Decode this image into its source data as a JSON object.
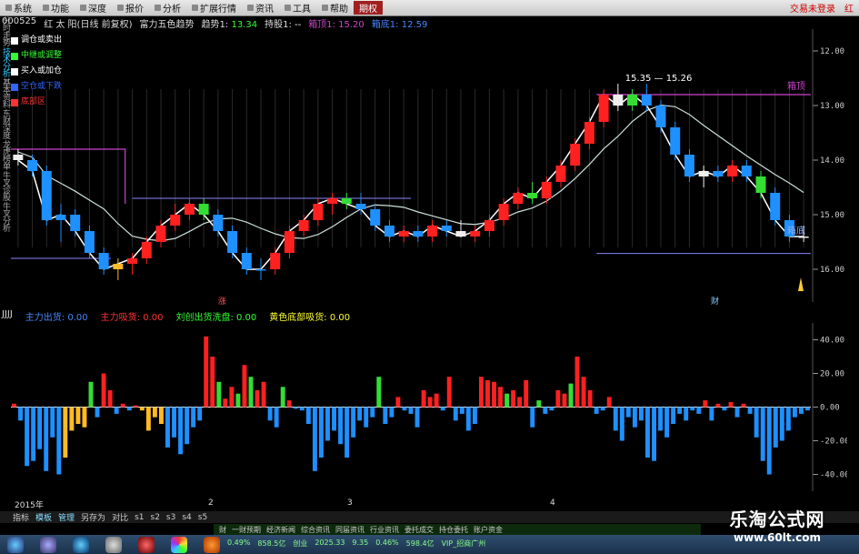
{
  "menu": {
    "items": [
      "系统",
      "功能",
      "深度",
      "报价",
      "分析",
      "扩展行情",
      "资讯",
      "工具",
      "帮助",
      "期权"
    ],
    "right": [
      "交易未登录",
      "红"
    ]
  },
  "left_tabs": [
    "分时走势",
    "技术分析",
    "基本资料",
    "东财深度",
    "龙虎榜单",
    "牛叉诊股",
    "牛叉分析"
  ],
  "info": {
    "code": "000525",
    "name": "红 太 阳(日线 前复权)",
    "indicator": "富力五色趋势",
    "trend_label": "趋势1:",
    "trend_value": "13.34",
    "hold_label": "持股1:",
    "hold_value": "--",
    "top_label": "箱顶1:",
    "top_value": "15.20",
    "bottom_label": "箱底1:",
    "bottom_value": "12.59"
  },
  "legend": [
    {
      "label": "调仓或卖出",
      "color": "#ffffff"
    },
    {
      "label": "中继或调整",
      "color": "#33ff33"
    },
    {
      "label": "买入或加仓",
      "color": "#ffffff"
    },
    {
      "label": "空仓或下跌",
      "color": "#3366ff"
    },
    {
      "label": "底部区",
      "color": "#ff3333"
    }
  ],
  "price_chart": {
    "range_text": "15.35 — 15.26",
    "box_top_label": "箱顶",
    "box_bottom_label": "箱底",
    "marker_zhang": "涨",
    "marker_cai": "财",
    "y_ticks": [
      "16.00",
      "15.00",
      "14.00",
      "13.00",
      "12.00"
    ]
  },
  "osc": {
    "name": "JJJJ",
    "f1_label": "主力出货:",
    "f1_value": "0.00",
    "f2_label": "主力吸货:",
    "f2_value": "0.00",
    "f3_label": "刘创出货洗盘:",
    "f3_value": "0.00",
    "f4_label": "黄色底部吸货:",
    "f4_value": "0.00",
    "y_ticks": [
      "40.00",
      "20.00",
      "0.00",
      "-20.00",
      "-40.00"
    ]
  },
  "dates": [
    "2015年",
    "2",
    "3",
    "4"
  ],
  "bottom_tabs": [
    "指标",
    "模板",
    "管理",
    "另存为",
    "对比",
    "s1",
    "s2",
    "s3",
    "s4",
    "s5"
  ],
  "sub_bar": [
    "财",
    "一财预期",
    "经济新闻",
    "综合资讯",
    "同届资讯",
    "行业资讯",
    "委托成交",
    "持仓委托",
    "账户资金"
  ],
  "ticker": [
    "0.49%",
    "858.5亿",
    "创业",
    "2025.33",
    "9.35",
    "0.46%",
    "598.4亿",
    "VIP_招商广州"
  ],
  "watermark": {
    "title": "乐淘公式网",
    "url": "www.60lt.com"
  },
  "colors": {
    "up": "#ff2020",
    "down": "#1e90ff",
    "green": "#33dd33",
    "yellow": "#ffbb22",
    "white": "#eeeeee",
    "magenta": "#cc44cc",
    "ma": "#cce0dd"
  },
  "chart_data": [
    {
      "type": "candlestick",
      "y_ticks": [
        12,
        13,
        14,
        15,
        16
      ],
      "ylim": [
        11.4,
        16.4
      ],
      "box_top": 15.2,
      "box_bottom": 12.59,
      "candles": [
        [
          14.1,
          14.2,
          13.9,
          14.0,
          "w"
        ],
        [
          14.0,
          14.1,
          13.7,
          13.8,
          "b"
        ],
        [
          13.8,
          13.9,
          12.8,
          12.9,
          "b"
        ],
        [
          12.9,
          13.2,
          12.5,
          13.0,
          "b"
        ],
        [
          13.0,
          13.1,
          12.6,
          12.7,
          "b"
        ],
        [
          12.7,
          12.8,
          12.2,
          12.3,
          "b"
        ],
        [
          12.3,
          12.4,
          11.9,
          12.0,
          "b"
        ],
        [
          12.0,
          12.2,
          11.8,
          12.1,
          "y"
        ],
        [
          12.1,
          12.3,
          11.9,
          12.2,
          "r"
        ],
        [
          12.2,
          12.6,
          12.1,
          12.5,
          "r"
        ],
        [
          12.5,
          12.9,
          12.4,
          12.8,
          "r"
        ],
        [
          12.8,
          13.2,
          12.7,
          13.0,
          "r"
        ],
        [
          13.0,
          13.3,
          12.9,
          13.2,
          "r"
        ],
        [
          13.2,
          13.3,
          12.9,
          13.0,
          "g"
        ],
        [
          13.0,
          13.1,
          12.6,
          12.7,
          "b"
        ],
        [
          12.7,
          12.8,
          12.2,
          12.3,
          "b"
        ],
        [
          12.3,
          12.4,
          11.9,
          12.0,
          "b"
        ],
        [
          12.0,
          12.2,
          11.8,
          12.0,
          "b"
        ],
        [
          12.0,
          12.4,
          11.9,
          12.3,
          "r"
        ],
        [
          12.3,
          12.8,
          12.2,
          12.7,
          "r"
        ],
        [
          12.7,
          13.0,
          12.6,
          12.9,
          "r"
        ],
        [
          12.9,
          13.3,
          12.8,
          13.2,
          "r"
        ],
        [
          13.2,
          13.4,
          13.0,
          13.3,
          "r"
        ],
        [
          13.3,
          13.4,
          13.1,
          13.2,
          "g"
        ],
        [
          13.2,
          13.4,
          13.0,
          13.1,
          "b"
        ],
        [
          13.1,
          13.2,
          12.7,
          12.8,
          "b"
        ],
        [
          12.8,
          12.9,
          12.5,
          12.6,
          "b"
        ],
        [
          12.6,
          12.8,
          12.5,
          12.7,
          "r"
        ],
        [
          12.7,
          12.8,
          12.5,
          12.6,
          "b"
        ],
        [
          12.6,
          12.9,
          12.5,
          12.8,
          "r"
        ],
        [
          12.8,
          12.9,
          12.6,
          12.7,
          "b"
        ],
        [
          12.7,
          12.9,
          12.6,
          12.6,
          "w"
        ],
        [
          12.6,
          12.8,
          12.5,
          12.7,
          "r"
        ],
        [
          12.7,
          13.0,
          12.6,
          12.9,
          "r"
        ],
        [
          12.9,
          13.3,
          12.8,
          13.2,
          "r"
        ],
        [
          13.2,
          13.5,
          13.1,
          13.4,
          "r"
        ],
        [
          13.4,
          13.6,
          13.2,
          13.3,
          "g"
        ],
        [
          13.3,
          13.7,
          13.2,
          13.6,
          "r"
        ],
        [
          13.6,
          14.0,
          13.5,
          13.9,
          "r"
        ],
        [
          13.9,
          14.4,
          13.8,
          14.3,
          "r"
        ],
        [
          14.3,
          14.8,
          14.2,
          14.7,
          "r"
        ],
        [
          14.7,
          15.3,
          14.6,
          15.2,
          "r"
        ],
        [
          15.2,
          15.4,
          14.9,
          15.0,
          "w"
        ],
        [
          15.0,
          15.3,
          14.9,
          15.2,
          "g"
        ],
        [
          15.2,
          15.4,
          14.9,
          15.0,
          "b"
        ],
        [
          15.0,
          15.1,
          14.5,
          14.6,
          "b"
        ],
        [
          14.6,
          14.7,
          14.0,
          14.1,
          "b"
        ],
        [
          14.1,
          14.2,
          13.6,
          13.7,
          "b"
        ],
        [
          13.7,
          13.9,
          13.5,
          13.8,
          "w"
        ],
        [
          13.8,
          13.9,
          13.6,
          13.7,
          "b"
        ],
        [
          13.7,
          14.0,
          13.6,
          13.9,
          "r"
        ],
        [
          13.9,
          14.0,
          13.6,
          13.7,
          "b"
        ],
        [
          13.7,
          13.8,
          13.3,
          13.4,
          "g"
        ],
        [
          13.4,
          13.5,
          12.8,
          12.9,
          "b"
        ],
        [
          12.9,
          13.0,
          12.5,
          12.6,
          "b"
        ],
        [
          12.6,
          12.8,
          12.5,
          12.6,
          "w"
        ]
      ]
    },
    {
      "type": "bar",
      "ylim": [
        -50,
        50
      ],
      "y_ticks": [
        40,
        20,
        0,
        -20,
        -40
      ],
      "values": [
        2,
        -8,
        -35,
        -32,
        -25,
        -38,
        -18,
        -40,
        -30,
        -14,
        -10,
        -12,
        15,
        -6,
        20,
        10,
        -4,
        2,
        -2,
        1,
        -2,
        -14,
        -6,
        -10,
        -24,
        -18,
        -28,
        -22,
        -12,
        -8,
        42,
        30,
        15,
        5,
        12,
        8,
        25,
        18,
        10,
        15,
        -8,
        -12,
        12,
        4,
        -1,
        -2,
        -10,
        -38,
        -30,
        -20,
        -14,
        -22,
        -30,
        -18,
        -8,
        -12,
        -6,
        18,
        -10,
        -6,
        6,
        -2,
        -4,
        -12,
        10,
        6,
        8,
        -2,
        18,
        -8,
        -4,
        -14,
        -10,
        18,
        16,
        15,
        12,
        8,
        10,
        6,
        16,
        -12,
        4,
        -4,
        -2,
        10,
        8,
        14,
        30,
        18,
        10,
        -4,
        -2,
        6,
        -14,
        -20,
        -6,
        -12,
        -8,
        -30,
        -32,
        -14,
        -18,
        -10,
        -4,
        -8,
        -2,
        -4,
        4,
        -8,
        2,
        -2,
        3,
        -6,
        2,
        -4,
        -18,
        -32,
        -40,
        -24,
        -20,
        -14,
        -6,
        -4,
        -2
      ]
    }
  ]
}
